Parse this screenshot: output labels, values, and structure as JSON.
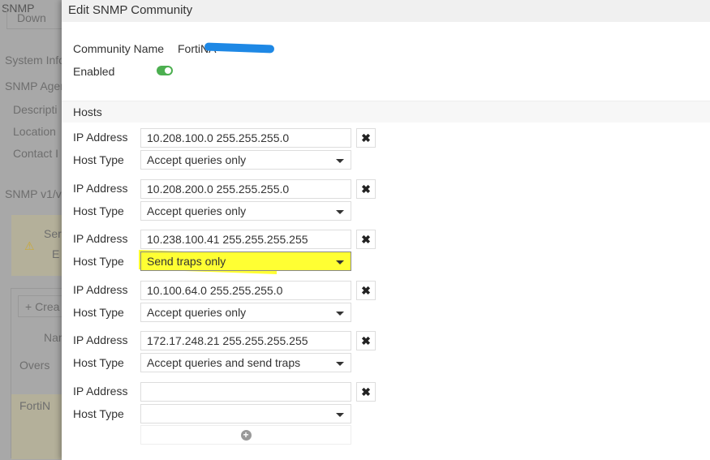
{
  "background": {
    "title": "SNMP",
    "download": "Down",
    "system_info": "System Info",
    "snmp_agent": "SNMP Agen",
    "description": "Descripti",
    "location": "Location",
    "contact": "Contact I",
    "snmp_v1": "SNMP v1/v",
    "warning_text": "Ser",
    "warning_btn": "E",
    "create": "+ Crea",
    "col_name": "Nar",
    "row1": "Overs",
    "row2": "FortiN"
  },
  "dialog": {
    "title": "Edit SNMP Community",
    "community_name_label": "Community Name",
    "community_name": "FortiNA",
    "enabled_label": "Enabled",
    "enabled": true,
    "hosts_label": "Hosts",
    "ip_label": "IP Address",
    "type_label": "Host Type",
    "remove_icon": "✖",
    "add_icon": "+",
    "hosts": [
      {
        "ip": "10.208.100.0 255.255.255.0",
        "type": "Accept queries only"
      },
      {
        "ip": "10.208.200.0 255.255.255.0",
        "type": "Accept queries only"
      },
      {
        "ip": "10.238.100.41 255.255.255.255",
        "type": "Send traps only"
      },
      {
        "ip": "10.100.64.0 255.255.255.0",
        "type": "Accept queries only"
      },
      {
        "ip": "172.17.248.21 255.255.255.255",
        "type": "Accept queries and send traps"
      },
      {
        "ip": "",
        "type": ""
      }
    ]
  },
  "colors": {
    "highlight": "#ffff33",
    "toggle": "#4caf50"
  }
}
